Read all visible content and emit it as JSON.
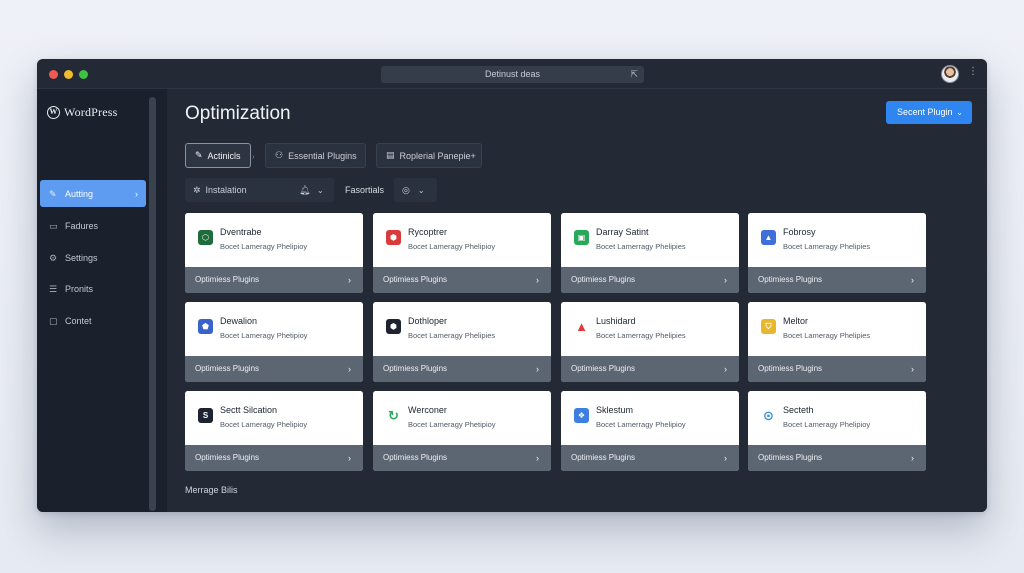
{
  "window": {
    "url": "Detinust deas",
    "colors": {
      "accent": "#2f86f0",
      "sidebar_active": "#5d9cf0",
      "bg": "#1e2430"
    }
  },
  "sidebar": {
    "brand": "WordPress",
    "items": [
      {
        "label": "Autting",
        "icon": "paint-icon",
        "active": true
      },
      {
        "label": "Fadures",
        "icon": "document-icon",
        "active": false
      },
      {
        "label": "Settings",
        "icon": "settings-icon",
        "active": false
      },
      {
        "label": "Pronits",
        "icon": "list-icon",
        "active": false
      },
      {
        "label": "Contet",
        "icon": "page-icon",
        "active": false
      }
    ]
  },
  "header": {
    "title": "Optimization",
    "primary_button": "Secent Plugin"
  },
  "tabs": [
    {
      "label": "Actinicls",
      "icon": "pencil-icon",
      "active": true
    },
    {
      "label": "Essential Plugins",
      "icon": "user-icon",
      "active": false
    },
    {
      "label": "Roplerial Panepie+",
      "icon": "grid-icon",
      "active": false
    }
  ],
  "filters": {
    "installation": "Instalation",
    "label": "Fasortials"
  },
  "cards": [
    {
      "name": "Dventrabe",
      "desc": "Bocet Lameragy Phelipioy",
      "footer": "Optimiess Plugins",
      "icon": "shield-icon",
      "color": "#1f6b3a"
    },
    {
      "name": "Rycoptrer",
      "desc": "Bocet Lameragy Phelipioy",
      "footer": "Optimiess Plugins",
      "icon": "hexagon-icon",
      "color": "#d93b3b"
    },
    {
      "name": "Darray Satint",
      "desc": "Bocet Lamerragy Phelipies",
      "footer": "Optimiess Plugins",
      "icon": "square-icon",
      "color": "#2aa85a"
    },
    {
      "name": "Fobrosy",
      "desc": "Bocet Lameragy Phelipies",
      "footer": "Optimiess Plugins",
      "icon": "triangle-icon",
      "color": "#3f6fd8"
    },
    {
      "name": "Dewalion",
      "desc": "Bocet Lameragy Phetipioy",
      "footer": "Optimiess Plugins",
      "icon": "badge-icon",
      "color": "#3a63c9"
    },
    {
      "name": "Dothloper",
      "desc": "Bocet Lameragy Phelipies",
      "footer": "Optimiess Plugins",
      "icon": "hexagon-icon",
      "color": "#1d2330"
    },
    {
      "name": "Lushidard",
      "desc": "Bocet Lamerragy Phelipies",
      "footer": "Optimiess Plugins",
      "icon": "warning-icon",
      "color": "#e03a3a"
    },
    {
      "name": "Meltor",
      "desc": "Bocet Lameragy Phelipies",
      "footer": "Optimiess Plugins",
      "icon": "shield-icon",
      "color": "#e8b72c"
    },
    {
      "name": "Sectt Silcation",
      "desc": "Bocet Lameragy Phelipioy",
      "footer": "Optimiess Plugins",
      "icon": "s-icon",
      "color": "#1d2330"
    },
    {
      "name": "Werconer",
      "desc": "Bocet Lameragy Phetipioy",
      "footer": "Optimiess Plugins",
      "icon": "refresh-icon",
      "color": "#2aa85a"
    },
    {
      "name": "Sklestum",
      "desc": "Bocet Lamerragy Phelipioy",
      "footer": "Optimiess Plugins",
      "icon": "code-icon",
      "color": "#3d7fe0"
    },
    {
      "name": "Secteth",
      "desc": "Bocet Lameragy Phelipioy",
      "footer": "Optimiess Plugins",
      "icon": "pin-icon",
      "color": "#2f8fd9"
    }
  ],
  "footer_label": "Merrage Bilis"
}
